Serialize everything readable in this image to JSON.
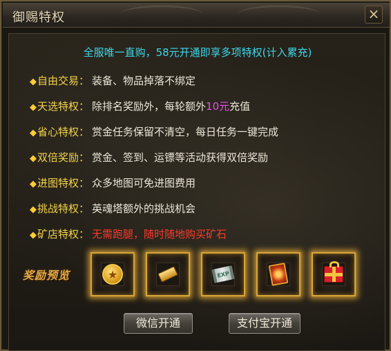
{
  "window": {
    "title": "御赐特权"
  },
  "headline": "全服唯一直购，58元开通即享多项特权(计入累充)",
  "features": [
    {
      "label": "自由交易",
      "desc": "装备、物品掉落不绑定"
    },
    {
      "label": "天选特权",
      "desc_before": "除排名奖励外，每轮额外",
      "desc_highlight": "10元",
      "desc_after": "充值"
    },
    {
      "label": "省心特权",
      "desc": "赏金任务保留不清空，每日任务一键完成"
    },
    {
      "label": "双倍奖励",
      "desc": "赏金、签到、运镖等活动获得双倍奖励"
    },
    {
      "label": "进图特权",
      "desc": "众多地图可免进图费用"
    },
    {
      "label": "挑战特权",
      "desc": "英魂塔额外的挑战机会"
    },
    {
      "label": "矿店特权",
      "desc": "无需跑腿，随时随地购买矿石"
    }
  ],
  "rewards": {
    "title": "奖励预览",
    "items": [
      {
        "icon": "gold-coin-icon"
      },
      {
        "icon": "gold-bar-icon"
      },
      {
        "icon": "exp-scroll-icon",
        "text": "EXP"
      },
      {
        "icon": "card-icon"
      },
      {
        "icon": "gift-box-icon"
      }
    ]
  },
  "buttons": {
    "wechat": "微信开通",
    "alipay": "支付宝开通"
  },
  "colors": {
    "headline": "#3fd6e9",
    "label": "#f4d34a",
    "highlight_purple": "#e64fe6",
    "desc_red": "#ff3a2a",
    "slot_glow": "#d8a53a"
  }
}
